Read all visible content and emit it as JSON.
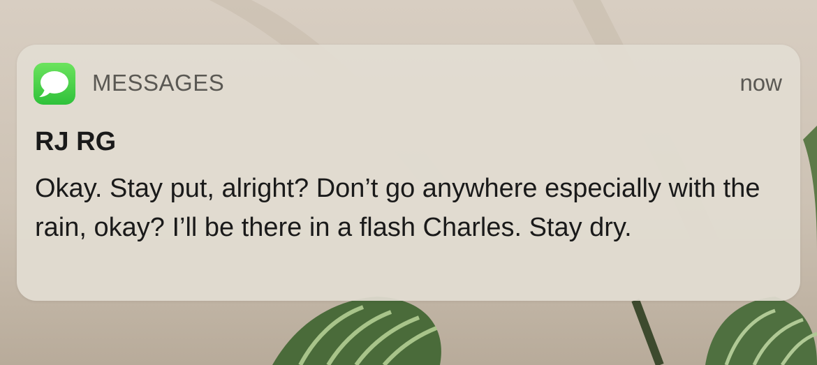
{
  "notification": {
    "app_name": "MESSAGES",
    "app_icon": "messages-bubble-icon",
    "time": "now",
    "sender": "RJ RG",
    "message": "Okay. Stay put, alright? Don’t go anywhere especially with the rain, okay? I’ll be there in a flash Charles. Stay dry."
  },
  "colors": {
    "icon_green": "#34c759",
    "secondary_text": "#5a5853",
    "primary_text": "#1a1a1a"
  }
}
